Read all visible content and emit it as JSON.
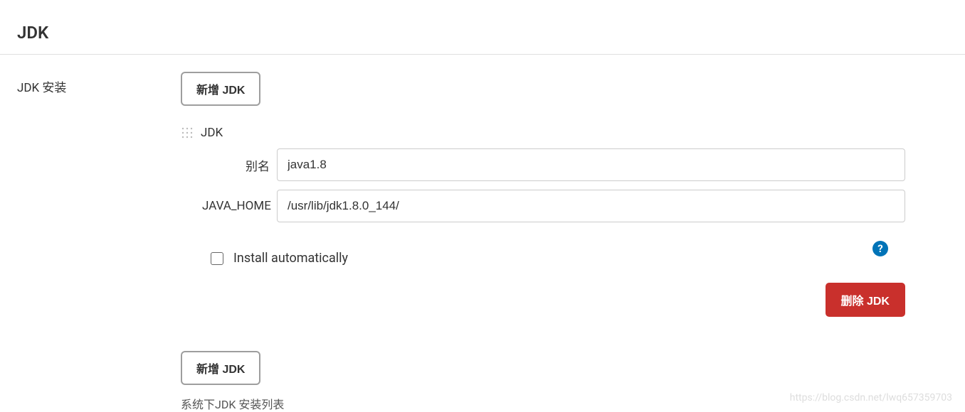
{
  "section": {
    "title": "JDK"
  },
  "install": {
    "label": "JDK 安装",
    "addButton": "新增 JDK",
    "entry": {
      "title": "JDK",
      "aliasLabel": "别名",
      "aliasValue": "java1.8",
      "javaHomeLabel": "JAVA_HOME",
      "javaHomeValue": "/usr/lib/jdk1.8.0_144/",
      "autoInstallLabel": "Install automatically",
      "deleteButton": "删除 JDK"
    },
    "helperText": "系统下JDK 安装列表"
  },
  "helpIcon": "?",
  "watermark": "https://blog.csdn.net/lwq657359703"
}
